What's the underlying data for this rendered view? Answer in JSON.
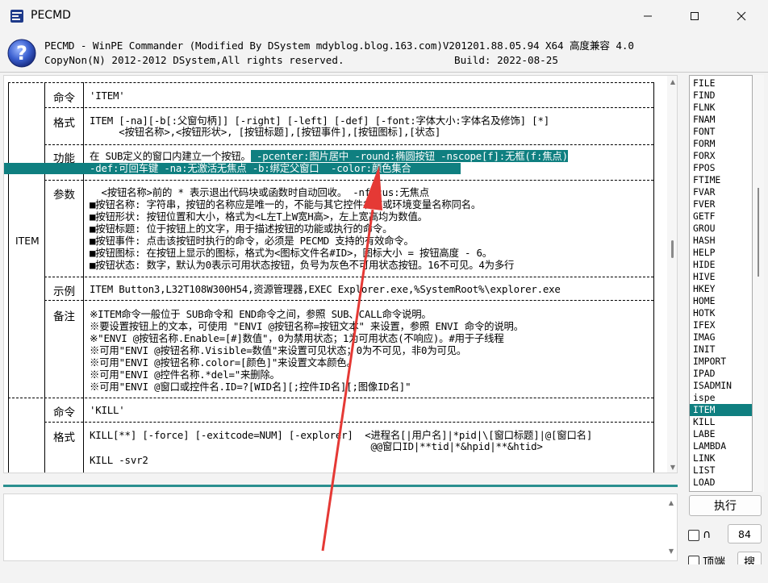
{
  "window": {
    "title": "PECMD"
  },
  "header": {
    "line1": "PECMD - WinPE Commander (Modified By DSystem mdyblog.blog.163.com)V201201.88.05.94 X64 高度兼容 4.0",
    "line2": "CopyNon(N) 2012-2012 DSystem,All rights reserved.",
    "build": "Build: 2022-08-25"
  },
  "doc": {
    "item_label": "ITEM",
    "rows": {
      "cmd_label": "命令",
      "cmd_value": "'ITEM'",
      "fmt_label": "格式",
      "fmt_line1": "ITEM [-na][-b[:父窗句柄]] [-right] [-left] [-def] [-font:字体大小:字体名及修饰] [*]",
      "fmt_line2": "     <按钮名称>,<按钮形状>, [按钮标题],[按钮事件],[按钮图标],[状态]",
      "func_label": "功能",
      "func_line1": "在 SUB定义的窗口内建立一个按钮。",
      "func_line1_hl": " -pcenter:图片居中 -round:椭圆按钮 -nscope[f]:无框(f:焦点)",
      "func_line2_hl": "-def:可回车键 -na:无激活无焦点 -b:绑定父窗口  -color:颜色集合",
      "param_label": "参数",
      "params": [
        "  <按钮名称>前的 * 表示退出代码块或函数时自动回收。 -nfocus:无焦点",
        "■按钮名称: 字符串，按钮的名称应是唯一的，不能与其它控件名称或环境变量名称同名。",
        "■按钮形状: 按钮位置和大小，格式为<L左T上W宽H高>，左上宽高均为数值。",
        "■按钮标题: 位于按钮上的文字，用于描述按钮的功能或执行的命令。",
        "■按钮事件: 点击该按钮时执行的命令，必须是 PECMD 支持的有效命令。",
        "■按钮图标: 在按钮上显示的图标，格式为<图标文件名#ID>，图标大小 = 按钮高度 - 6。",
        "■按钮状态: 数字，默认为0表示可用状态按钮，负号为灰色不可用状态按钮。16不可见。4为多行"
      ],
      "example_label": "示例",
      "example": "ITEM Button3,L32T108W300H54,资源管理器,EXEC Explorer.exe,%SystemRoot%\\explorer.exe",
      "note_label": "备注",
      "notes": [
        "※ITEM命令一般位于 SUB命令和 END命令之间，参照 SUB、CALL命令说明。",
        "※要设置按钮上的文本，可使用 \"ENVI @按钮名称=按钮文本\" 来设置，参照 ENVI 命令的说明。",
        "※\"ENVI @按钮名称.Enable=[#]数值\"，0为禁用状态；1为可用状态(不响应)。#用于子线程",
        "※可用\"ENVI @按钮名称.Visible=数值\"来设置可见状态；0为不可见，非0为可见。",
        "※可用\"ENVI @按钮名称.color=[颜色]\"来设置文本颜色。",
        "※可用\"ENVI @控件名称.*del=\"来删除。",
        "※可用\"ENVI @窗口或控件名.ID=?[WID名][;控件ID名][;图像ID名]\""
      ],
      "kill_cmd_label": "命令",
      "kill_cmd_value": "'KILL'",
      "kill_fmt_label": "格式",
      "kill_fmt_line1": "KILL[**] [-force] [-exitcode=NUM] [-explorer]  <进程名[|用户名]|*pid|\\[窗口标题]|@[窗口名]",
      "kill_fmt_line2": "                                                @@窗口ID|**tid|*&hpid|**&htid>",
      "kill_fmt_line3": "KILL -svr2"
    }
  },
  "keywords": [
    "FILE",
    "FIND",
    "FLNK",
    "FNAM",
    "FONT",
    "FORM",
    "FORX",
    "FPOS",
    "FTIME",
    "FVAR",
    "FVER",
    "GETF",
    "GROU",
    "HASH",
    "HELP",
    "HIDE",
    "HIVE",
    "HKEY",
    "HOME",
    "HOTK",
    "IFEX",
    "IMAG",
    "INIT",
    "IMPORT",
    "IPAD",
    "ISADMIN",
    "ispe",
    "ITEM",
    "KILL",
    "LABE",
    "LAMBDA",
    "LINK",
    "LIST",
    "LOAD"
  ],
  "selected_keyword": "ITEM",
  "controls": {
    "exec_label": "执行",
    "case_label": "∩",
    "font_size": "84",
    "topmost_label": "顶端",
    "search_label": "搜"
  },
  "colors": {
    "accent": "#0f7f80",
    "arrow": "#e53935"
  }
}
